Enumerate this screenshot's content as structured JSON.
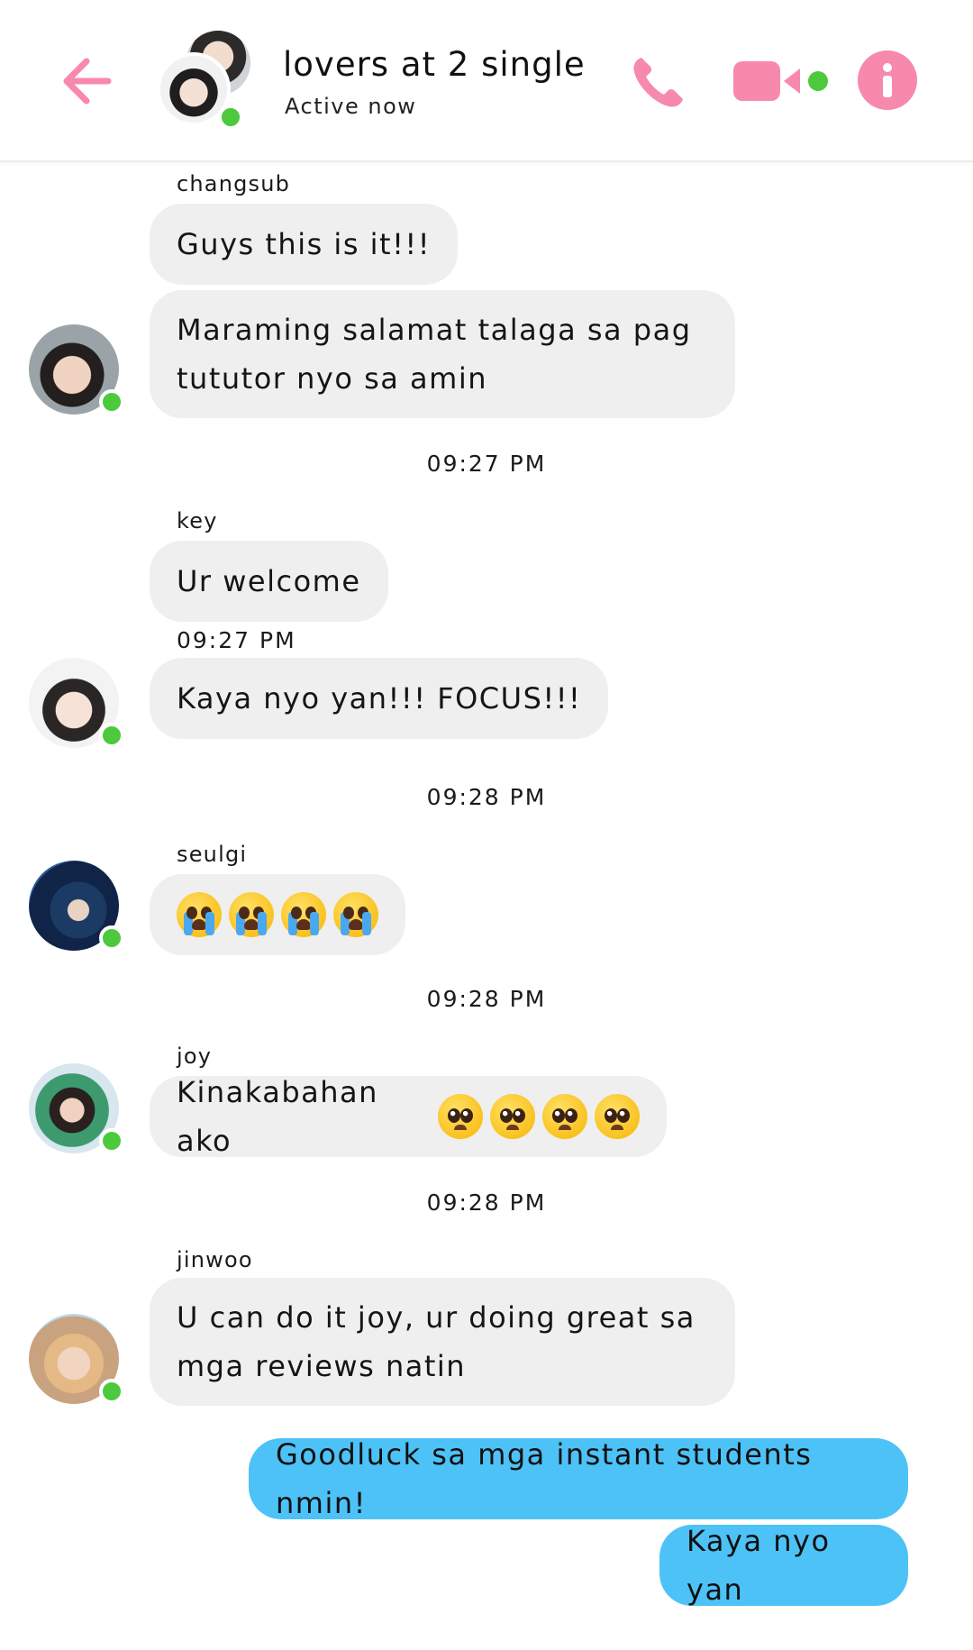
{
  "header": {
    "title": "lovers at 2 single",
    "status": "Active now",
    "icons": {
      "back": "arrow-left-icon",
      "phone": "phone-icon",
      "video": "video-camera-icon",
      "info": "info-icon"
    },
    "colors": {
      "accent": "#f789ac",
      "online": "#4cc93c"
    }
  },
  "messages": {
    "changsub": {
      "sender": "changsub",
      "m1": "Guys this is it!!!",
      "m2_line1": "Maraming salamat talaga sa pag",
      "m2_line2": "tututor nyo sa amin"
    },
    "time1": "09:27 PM",
    "key": {
      "sender": "key",
      "m1": "Ur welcome",
      "time": "09:27 PM",
      "m2": "Kaya nyo yan!!! FOCUS!!!"
    },
    "time2": "09:28 PM",
    "seulgi": {
      "sender": "seulgi",
      "emoji": "loudly-crying-face x4"
    },
    "time3": "09:28 PM",
    "joy": {
      "sender": "joy",
      "text": "Kinakabahan ako",
      "emoji": "pleading-face x4"
    },
    "time4": "09:28 PM",
    "jinwoo": {
      "sender": "jinwoo",
      "line1": "U can do it joy, ur doing great sa",
      "line2": "mga reviews natin"
    },
    "sent": {
      "m1": "Goodluck sa mga instant students nmin!",
      "m2": "Kaya nyo yan"
    },
    "colors": {
      "received_bubble": "#efefef",
      "sent_bubble": "#4dc2f7"
    }
  }
}
